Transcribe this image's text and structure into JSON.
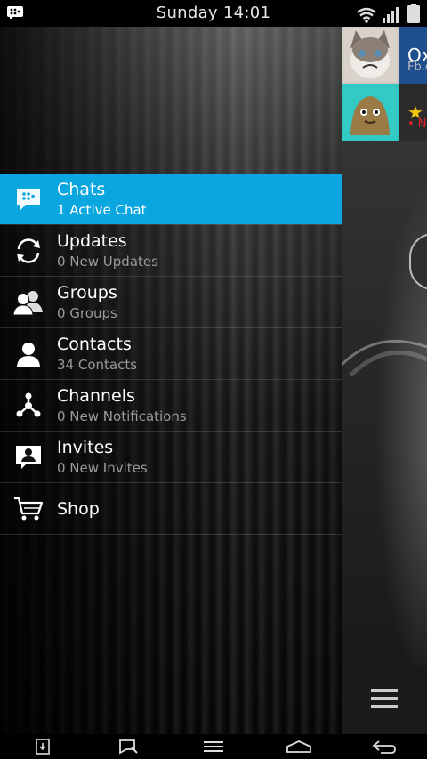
{
  "status_bar": {
    "time": "Sunday 14:01",
    "icons": [
      "bbm-notification-icon",
      "wifi-icon",
      "signal-icon",
      "battery-icon"
    ]
  },
  "menu": {
    "items": [
      {
        "title": "Chats",
        "subtitle": "1 Active Chat",
        "icon": "chats-icon",
        "active": true
      },
      {
        "title": "Updates",
        "subtitle": "0 New Updates",
        "icon": "updates-icon",
        "active": false
      },
      {
        "title": "Groups",
        "subtitle": "0 Groups",
        "icon": "groups-icon",
        "active": false
      },
      {
        "title": "Contacts",
        "subtitle": "34 Contacts",
        "icon": "contacts-icon",
        "active": false
      },
      {
        "title": "Channels",
        "subtitle": "0 New Notifications",
        "icon": "channels-icon",
        "active": false
      },
      {
        "title": "Invites",
        "subtitle": "0 New Invites",
        "icon": "invites-icon",
        "active": false
      },
      {
        "title": "Shop",
        "subtitle": "",
        "icon": "shop-icon",
        "active": false
      }
    ]
  },
  "background_panel": {
    "chat_rows": [
      {
        "name": "Ox",
        "meta": "Fb.c"
      },
      {
        "name": "★",
        "meta": "• N"
      }
    ]
  },
  "colors": {
    "accent": "#0aa6df",
    "subtitle_gray": "#9a9a9a"
  },
  "nav_bar": [
    "app-switcher-icon",
    "search-icon",
    "menu-icon",
    "home-icon",
    "back-icon"
  ]
}
